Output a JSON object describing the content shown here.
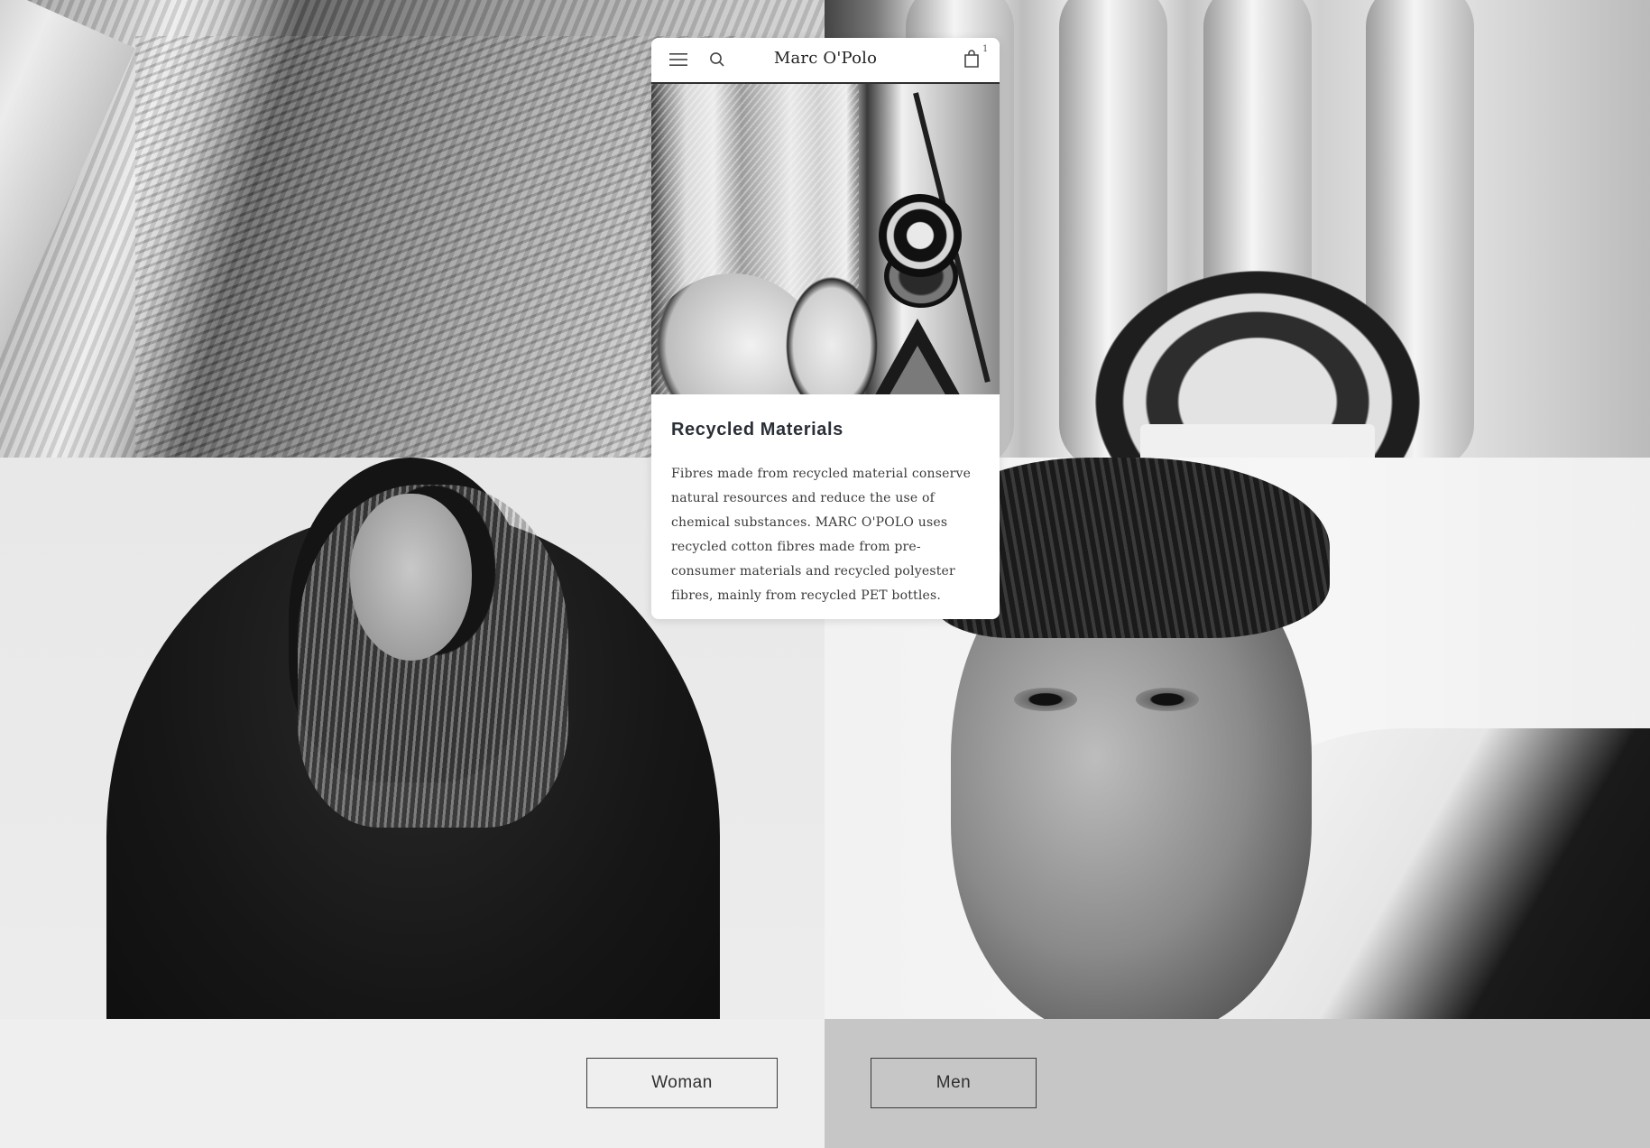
{
  "header": {
    "logo": "Marc O'Polo",
    "cart_count": "1"
  },
  "article": {
    "title": "Recycled Materials",
    "body": "Fibres made from recycled material conserve natural resources and reduce the use of chemical substances. MARC O'POLO uses recycled cotton fibres made from pre-consumer materials and recycled polyester fibres, mainly from recycled PET bottles."
  },
  "categories": {
    "woman_label": "Woman",
    "men_label": "Men"
  },
  "icons": {
    "menu": "menu-icon",
    "search": "search-icon",
    "bag": "shopping-bag-icon"
  },
  "colors": {
    "woman_bar": "#efefef",
    "men_bar": "#c6c6c6",
    "title_text": "#2a2f38"
  }
}
